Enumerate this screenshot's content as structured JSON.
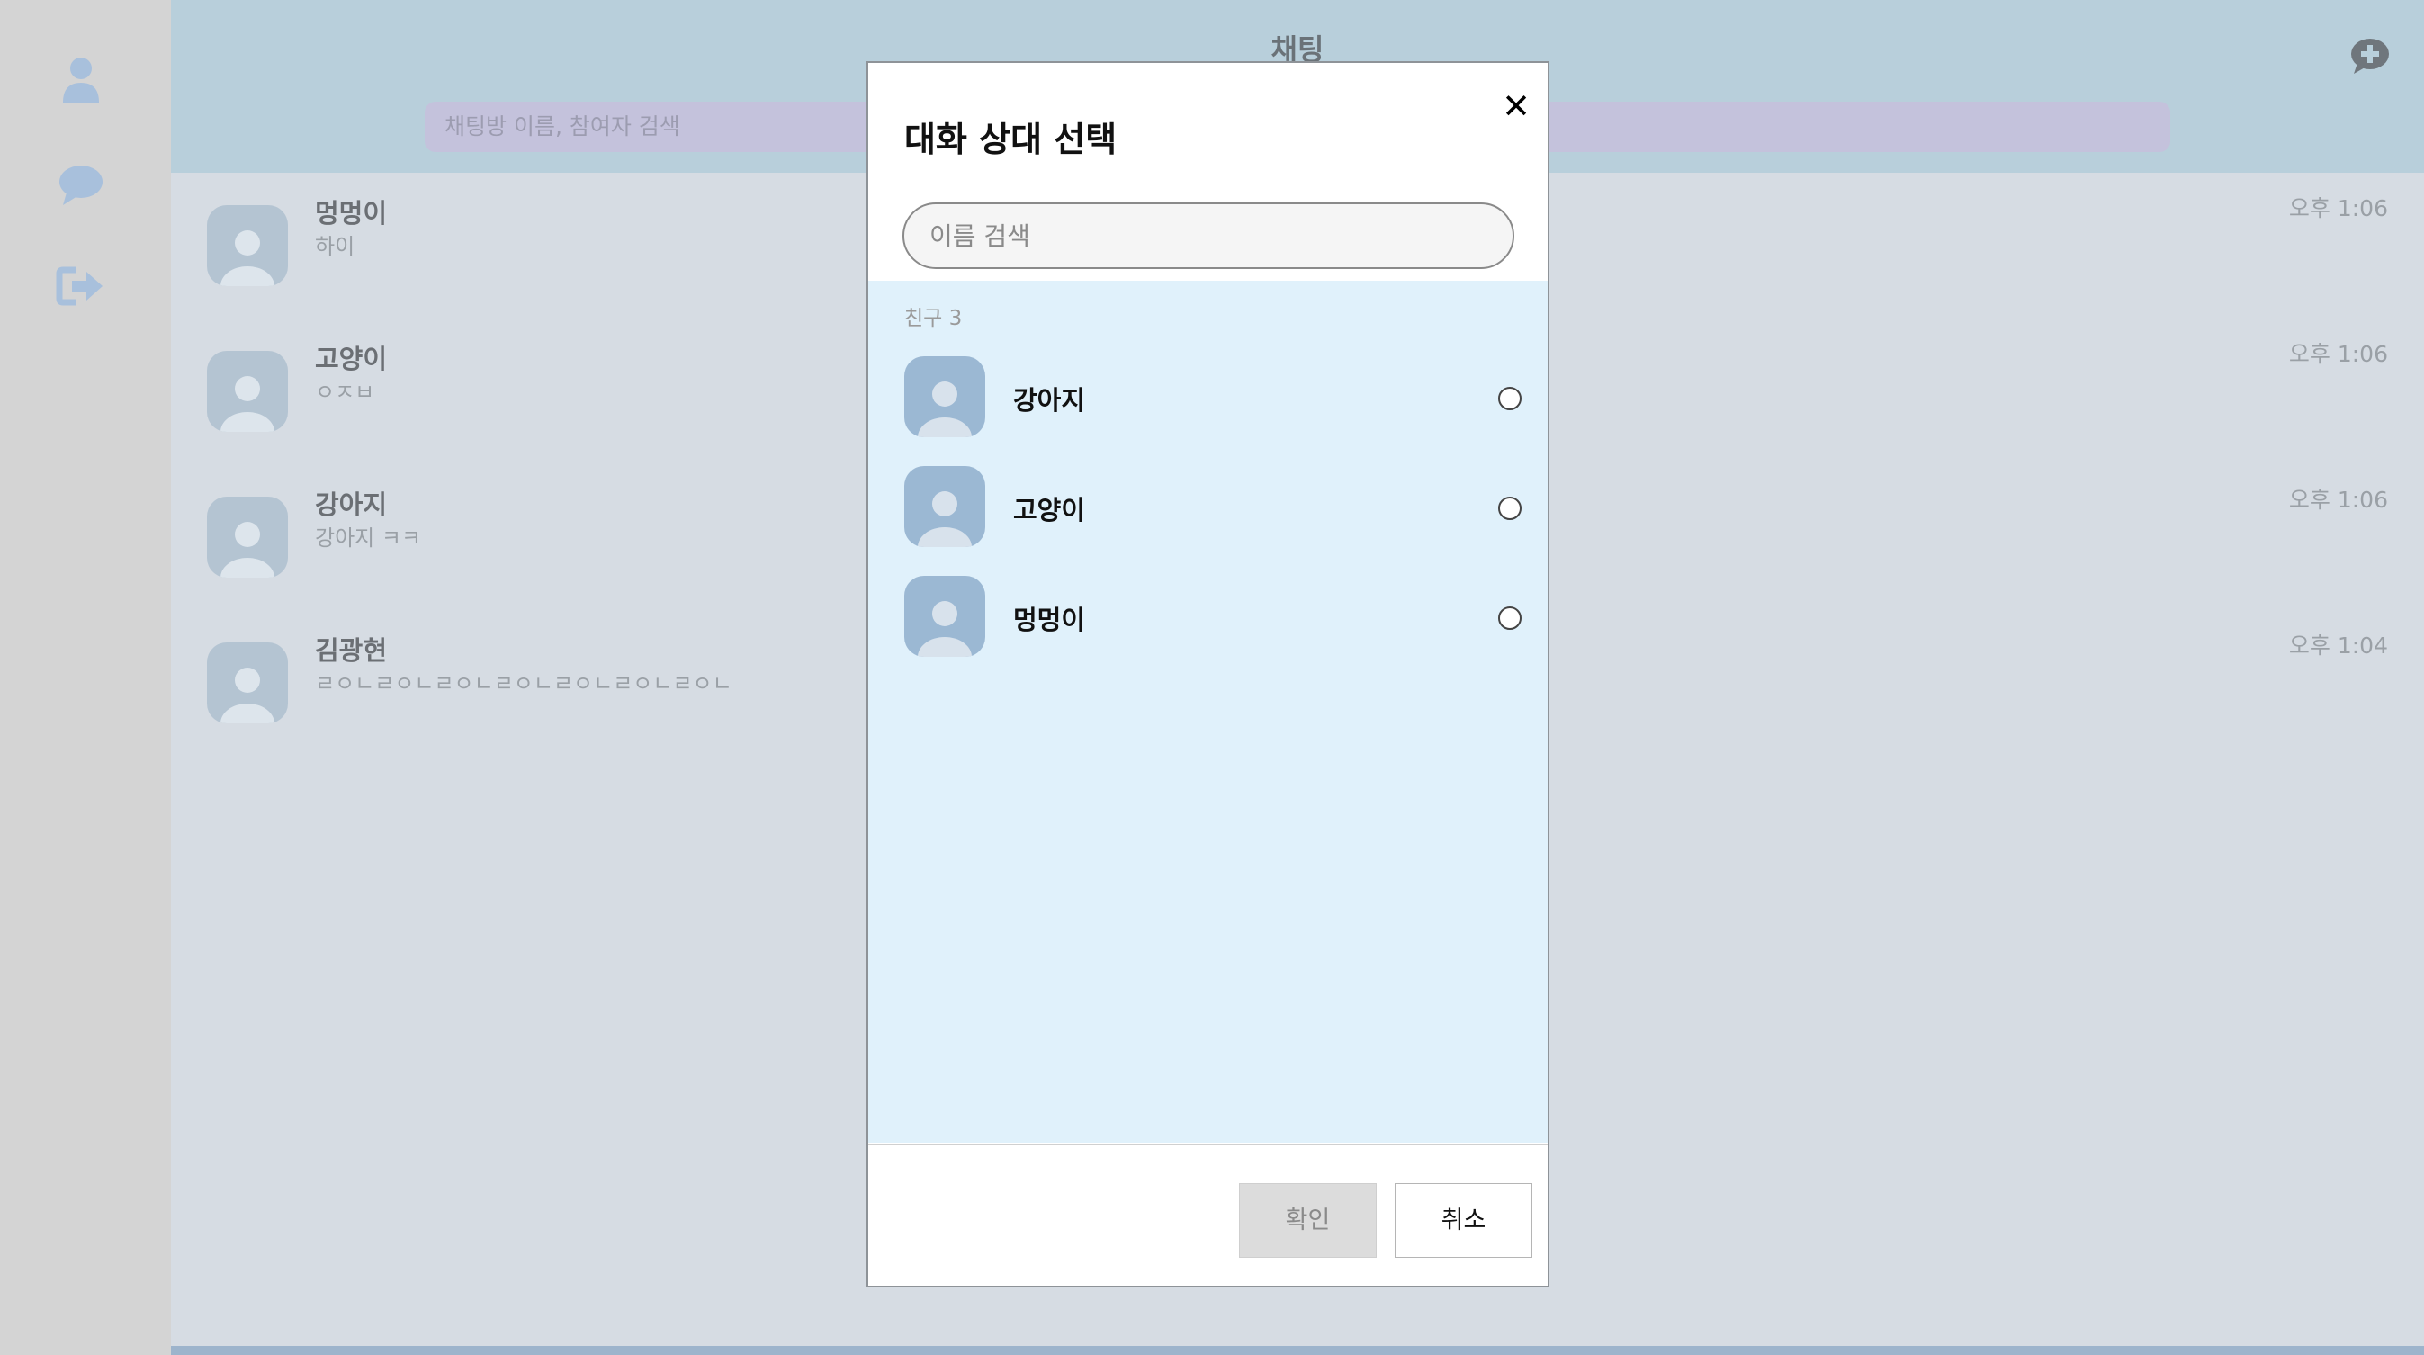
{
  "sidebar": {
    "items": [
      {
        "icon": "person-icon"
      },
      {
        "icon": "chat-bubble-icon"
      },
      {
        "icon": "sign-out-icon"
      }
    ],
    "icon_color": "#a8c0dc"
  },
  "header": {
    "title": "채팅",
    "search_placeholder": "채팅방 이름, 참여자 검색",
    "new_chat_icon": "chat-plus-icon"
  },
  "chats": [
    {
      "name": "멍멍이",
      "preview": "하이",
      "time": "오후 1:06"
    },
    {
      "name": "고양이",
      "preview": "ㅇㅈㅂ",
      "time": "오후 1:06"
    },
    {
      "name": "강아지",
      "preview": "강아지 ㅋㅋ",
      "time": "오후 1:06"
    },
    {
      "name": "김광현",
      "preview": "ㄹㅇㄴㄹㅇㄴㄹㅇㄴㄹㅇㄴㄹㅇㄴㄹㅇㄴㄹㅇㄴ",
      "time": "오후 1:04"
    }
  ],
  "modal": {
    "title": "대화 상대 선택",
    "close_label": "✕",
    "search_placeholder": "이름 검색",
    "friends_label": "친구 3",
    "friends": [
      {
        "name": "강아지",
        "selected": false
      },
      {
        "name": "고양이",
        "selected": false
      },
      {
        "name": "멍멍이",
        "selected": false
      }
    ],
    "confirm_label": "확인",
    "cancel_label": "취소"
  },
  "colors": {
    "header_bg": "#b8cfdb",
    "sidebar_bg": "#d4d4d4",
    "modal_list_bg": "#e0f1fb",
    "avatar_bg": "#9bb8d3"
  }
}
